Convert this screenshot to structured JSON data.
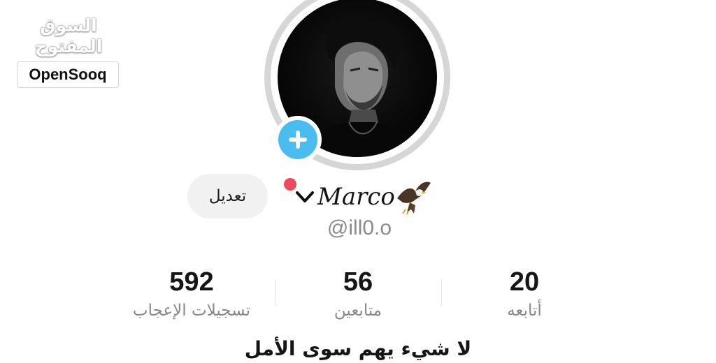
{
  "watermark": {
    "arabic_text": "السوق المفتوح",
    "latin_text": "OpenSooq"
  },
  "profile": {
    "display_name": "Marco",
    "username": "@ill0.o",
    "edit_label": "تعديل",
    "bio_partial": "لا شيء يهم سوى الأمل"
  },
  "stats": [
    {
      "value": "592",
      "label": "تسجيلات الإعجاب"
    },
    {
      "value": "56",
      "label": "متابعين"
    },
    {
      "value": "20",
      "label": "أتابعه"
    }
  ],
  "colors": {
    "accent_blue": "#49bdf0",
    "notify_red": "#ee4a5e",
    "button_bg": "#f1f1f2",
    "muted_text": "#888888"
  },
  "icons": [
    "plus-icon",
    "chevron-down-icon",
    "eagle-emoji-icon",
    "notification-dot"
  ]
}
